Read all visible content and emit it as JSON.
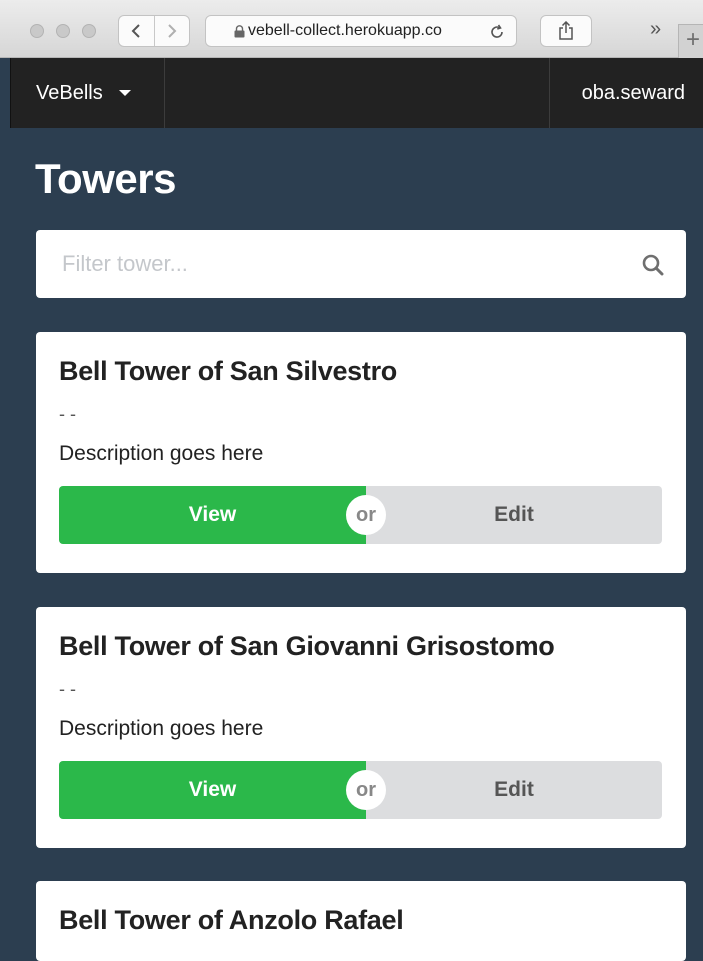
{
  "browser": {
    "url": "vebell-collect.herokuapp.co",
    "overflow_label": "»",
    "new_tab_label": "+"
  },
  "nav": {
    "brand": "VeBells",
    "user": "oba.seward"
  },
  "page": {
    "title": "Towers"
  },
  "search": {
    "placeholder": "Filter tower..."
  },
  "towers": [
    {
      "name": "Bell Tower of San Silvestro",
      "meta": "- -",
      "description": "Description goes here",
      "view_label": "View",
      "or_label": "or",
      "edit_label": "Edit"
    },
    {
      "name": "Bell Tower of San Giovanni Grisostomo",
      "meta": "- -",
      "description": "Description goes here",
      "view_label": "View",
      "or_label": "or",
      "edit_label": "Edit"
    },
    {
      "name": "Bell Tower of Anzolo Rafael"
    }
  ],
  "colors": {
    "background": "#2c3e50",
    "navbar": "#222222",
    "view_button": "#2bb84a",
    "edit_button": "#dcdddf"
  }
}
